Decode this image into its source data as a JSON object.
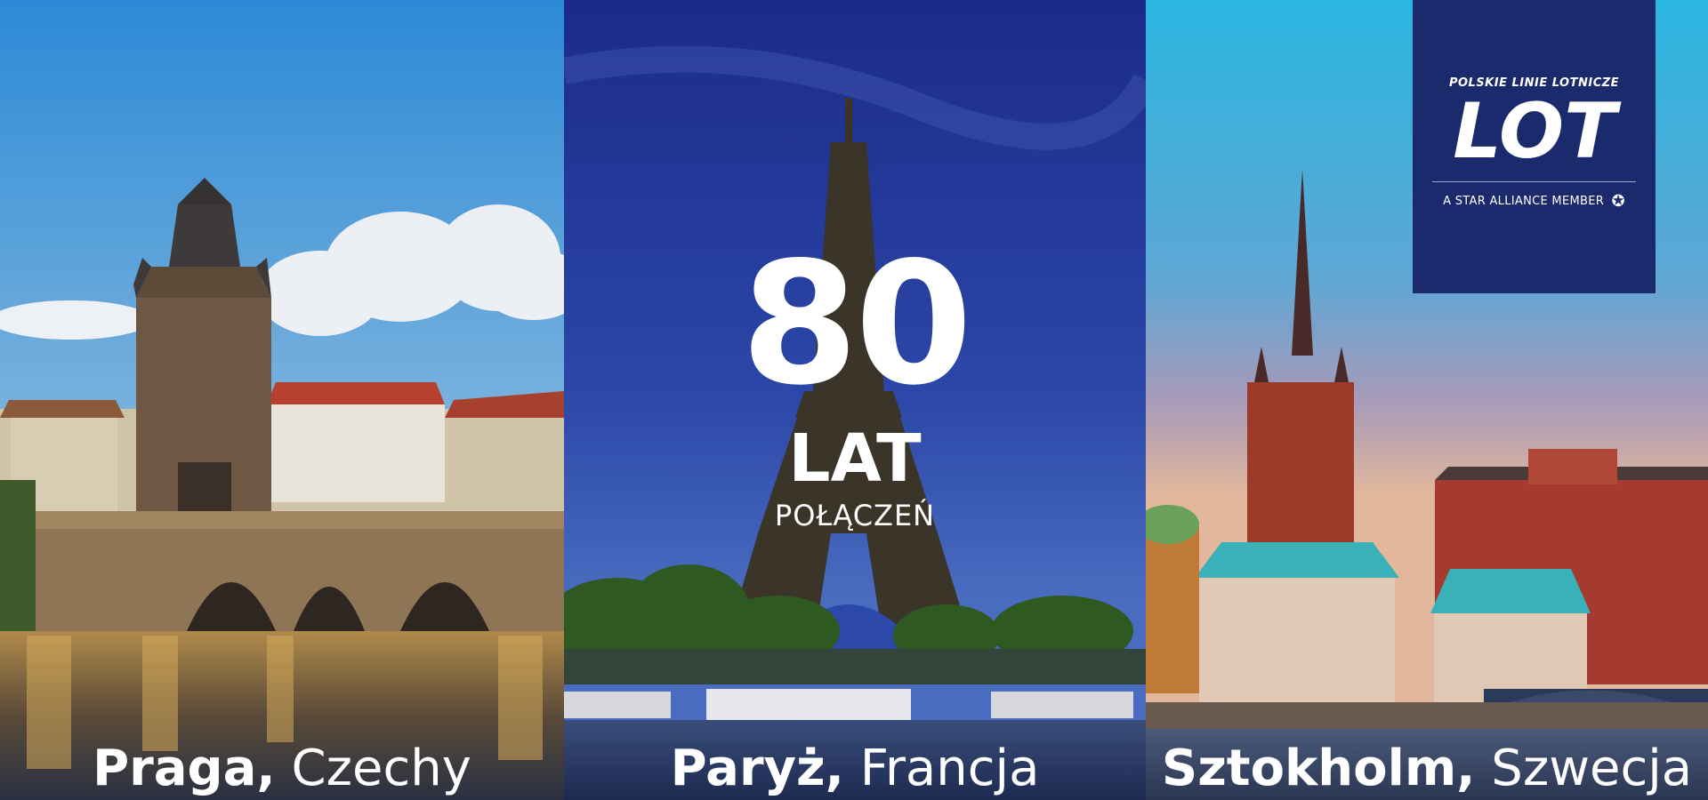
{
  "panels": [
    {
      "city": "Praga,",
      "country": "Czechy"
    },
    {
      "city": "Paryż,",
      "country": "Francja"
    },
    {
      "city": "Sztokholm,",
      "country": "Szwecja"
    }
  ],
  "anniversary": {
    "number": "80",
    "unit": "LAT",
    "subtitle": "POŁĄCZEŃ"
  },
  "logo": {
    "top_text": "POLSKIE LINIE LOTNICZE",
    "mark_text": "LOT",
    "bottom_text": "A STAR ALLIANCE MEMBER",
    "icon": "star-alliance-icon"
  },
  "colors": {
    "logo_background": "#1a2a6c",
    "text": "#ffffff"
  }
}
